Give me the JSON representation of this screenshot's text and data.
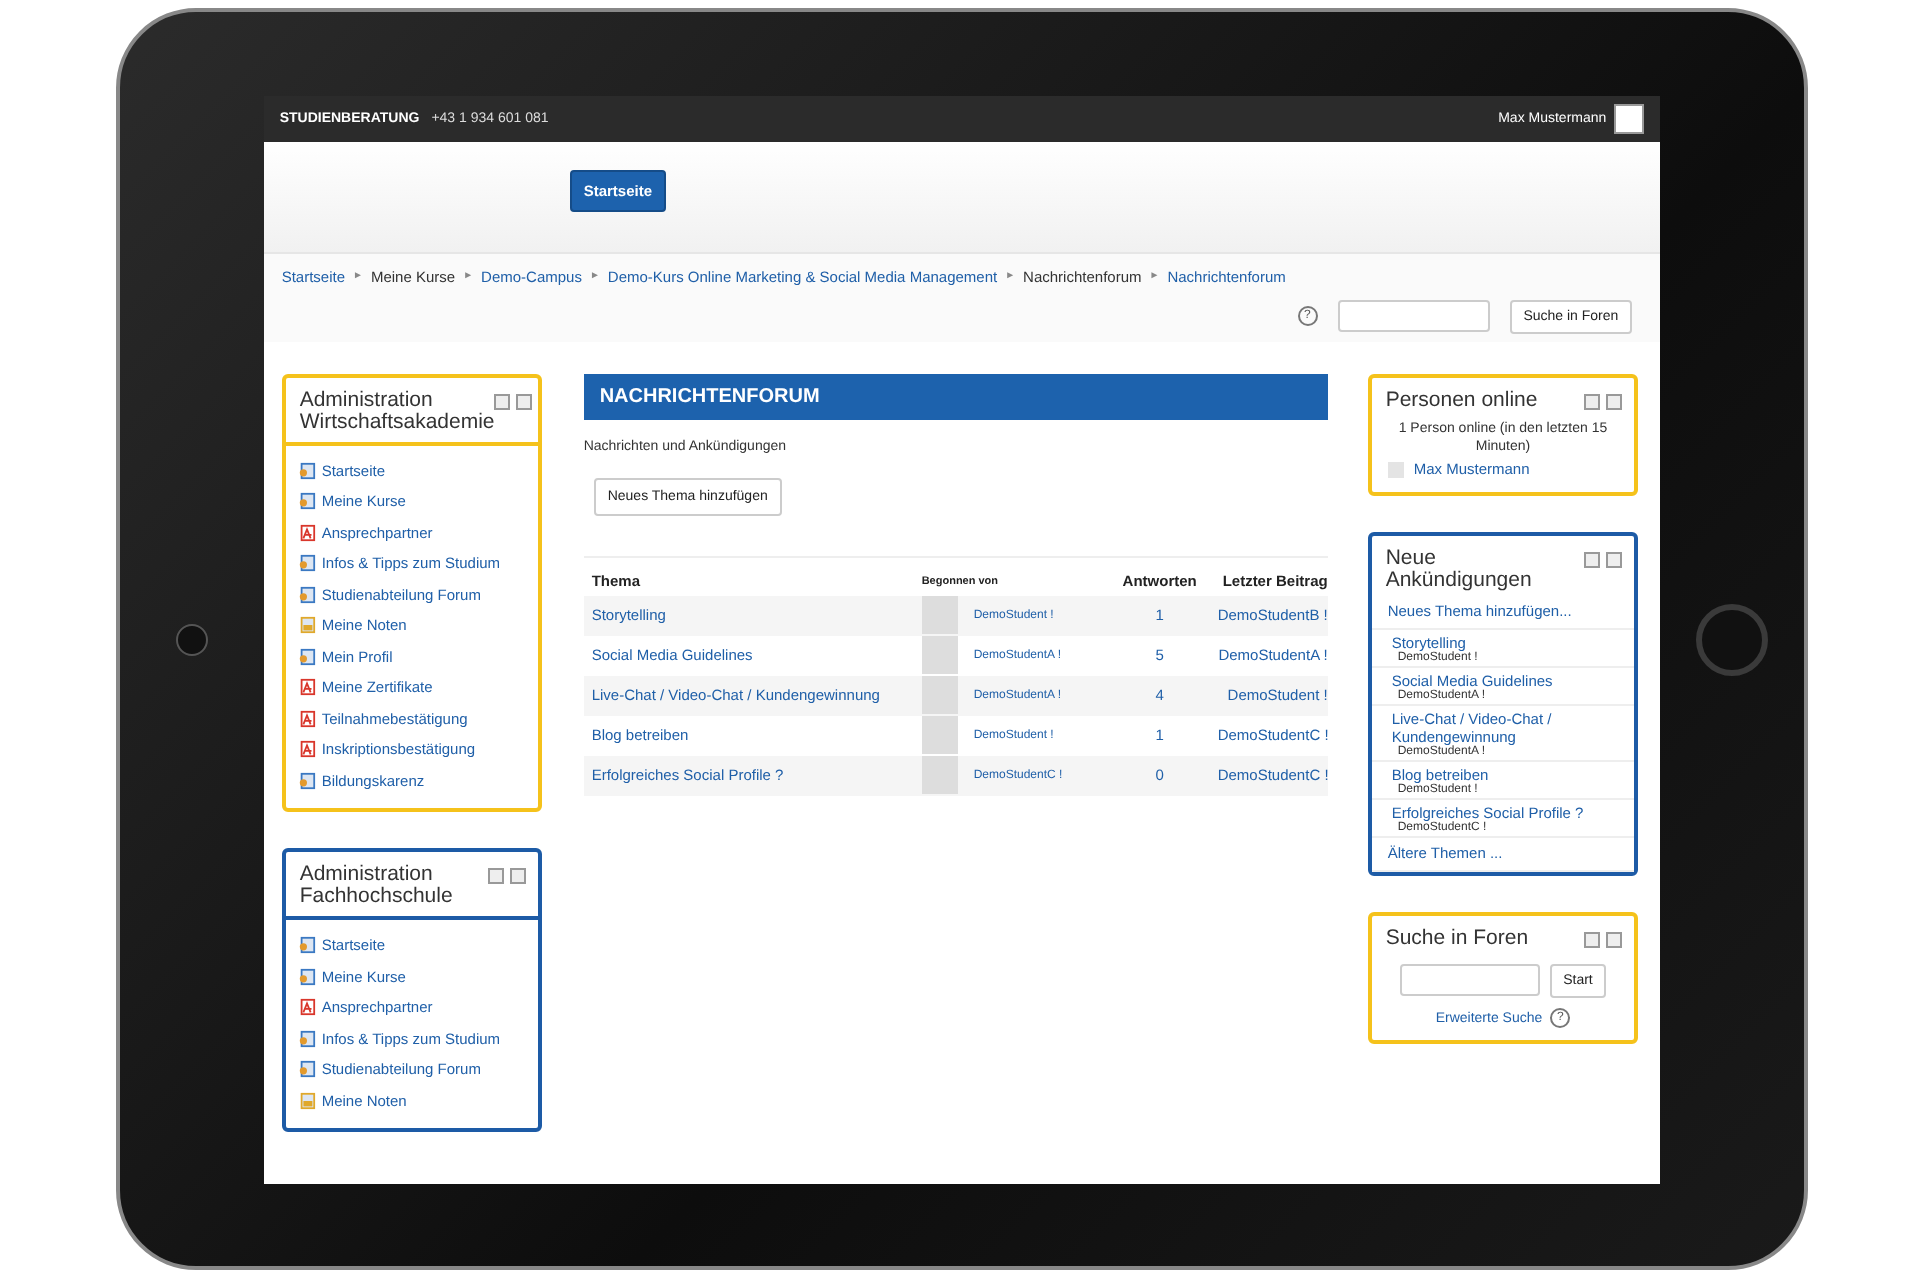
{
  "topbar": {
    "brand": "STUDIENBERATUNG",
    "phone": "+43 1 934 601 081",
    "user": "Max Mustermann"
  },
  "header": {
    "home_button": "Startseite"
  },
  "breadcrumb": [
    {
      "label": "Startseite",
      "link": true
    },
    {
      "label": "Meine Kurse",
      "link": false
    },
    {
      "label": "Demo-Campus",
      "link": true
    },
    {
      "label": "Demo-Kurs Online Marketing & Social Media Management",
      "link": true
    },
    {
      "label": "Nachrichtenforum",
      "link": false
    },
    {
      "label": "Nachrichtenforum",
      "link": true
    }
  ],
  "separator": "►",
  "forum_search": {
    "help": "?",
    "button": "Suche in Foren"
  },
  "left_blocks": [
    {
      "title": "Administration Wirtschaftsakademie",
      "color": "#f5c21b",
      "items": [
        {
          "label": "Startseite",
          "kind": "page"
        },
        {
          "label": "Meine Kurse",
          "kind": "page"
        },
        {
          "label": "Ansprechpartner",
          "kind": "pdf"
        },
        {
          "label": "Infos & Tipps zum Studium",
          "kind": "page"
        },
        {
          "label": "Studienabteilung Forum",
          "kind": "page"
        },
        {
          "label": "Meine Noten",
          "kind": "grade"
        },
        {
          "label": "Mein Profil",
          "kind": "page"
        },
        {
          "label": "Meine Zertifikate",
          "kind": "pdf"
        },
        {
          "label": "Teilnahmebestätigung",
          "kind": "pdf"
        },
        {
          "label": "Inskriptionsbestätigung",
          "kind": "pdf"
        },
        {
          "label": "Bildungskarenz",
          "kind": "page"
        }
      ]
    },
    {
      "title": "Administration Fachhochschule",
      "color": "#1d5ba6",
      "items": [
        {
          "label": "Startseite",
          "kind": "page"
        },
        {
          "label": "Meine Kurse",
          "kind": "page"
        },
        {
          "label": "Ansprechpartner",
          "kind": "pdf"
        },
        {
          "label": "Infos & Tipps zum Studium",
          "kind": "page"
        },
        {
          "label": "Studienabteilung Forum",
          "kind": "page"
        },
        {
          "label": "Meine Noten",
          "kind": "grade"
        }
      ]
    }
  ],
  "forum": {
    "title": "NACHRICHTENFORUM",
    "intro": "Nachrichten und Ankündigungen",
    "add_button": "Neues Thema hinzufügen",
    "columns": [
      "Thema",
      "Begonnen von",
      "Antworten",
      "Letzter Beitrag"
    ],
    "rows": [
      {
        "topic": "Storytelling",
        "started_by": "DemoStudent !",
        "replies": "1",
        "last_post": "DemoStudentB !"
      },
      {
        "topic": "Social Media Guidelines",
        "started_by": "DemoStudentA !",
        "replies": "5",
        "last_post": "DemoStudentA !"
      },
      {
        "topic": "Live-Chat / Video-Chat / Kundengewinnung",
        "started_by": "DemoStudentA !",
        "replies": "4",
        "last_post": "DemoStudent !"
      },
      {
        "topic": "Blog betreiben",
        "started_by": "DemoStudent !",
        "replies": "1",
        "last_post": "DemoStudentC !"
      },
      {
        "topic": "Erfolgreiches Social Profile ?",
        "started_by": "DemoStudentC !",
        "replies": "0",
        "last_post": "DemoStudentC !"
      }
    ]
  },
  "online_block": {
    "title": "Personen online",
    "color": "#f5c21b",
    "text": "1 Person online (in den letzten 15 Minuten)",
    "user": "Max Mustermann"
  },
  "news_block": {
    "title": "Neue Ankündigungen",
    "color": "#1d5ba6",
    "add_link": "Neues Thema hinzufügen...",
    "items": [
      {
        "topic": "Storytelling",
        "author": "DemoStudent !"
      },
      {
        "topic": "Social Media Guidelines",
        "author": "DemoStudentA !"
      },
      {
        "topic": "Live-Chat / Video-Chat / Kundengewinnung",
        "author": "DemoStudentA !"
      },
      {
        "topic": "Blog betreiben",
        "author": "DemoStudent !"
      },
      {
        "topic": "Erfolgreiches Social Profile ?",
        "author": "DemoStudentC !"
      }
    ],
    "older_link": "Ältere Themen ..."
  },
  "search_block": {
    "title": "Suche in Foren",
    "color": "#f5c21b",
    "button": "Start",
    "advanced_link": "Erweiterte Suche",
    "help": "?"
  }
}
